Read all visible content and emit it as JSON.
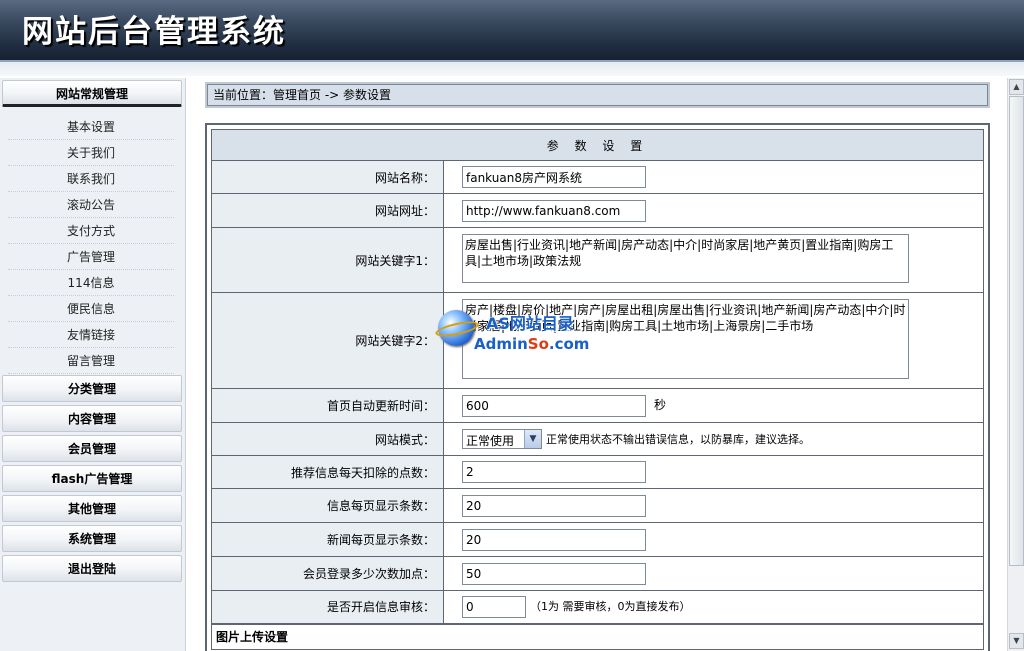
{
  "header": {
    "title": "网站后台管理系统"
  },
  "sidebar": {
    "active_category": "网站常规管理",
    "sub_items": [
      "基本设置",
      "关于我们",
      "联系我们",
      "滚动公告",
      "支付方式",
      "广告管理",
      "114信息",
      "便民信息",
      "友情链接",
      "留言管理"
    ],
    "categories": [
      "分类管理",
      "内容管理",
      "会员管理",
      "flash广告管理",
      "其他管理",
      "系统管理"
    ],
    "logout": "退出登陆"
  },
  "breadcrumb": "当前位置：管理首页 -> 参数设置",
  "form": {
    "title": "参 数 设 置",
    "site_name": {
      "label": "网站名称：",
      "value": "fankuan8房产网系统"
    },
    "site_url": {
      "label": "网站网址：",
      "value": "http://www.fankuan8.com"
    },
    "keywords1": {
      "label": "网站关键字1：",
      "value": "房屋出售|行业资讯|地产新闻|房产动态|中介|时尚家居|地产黄页|置业指南|购房工具|土地市场|政策法规"
    },
    "keywords2": {
      "label": "网站关键字2：",
      "value": "房产|楼盘|房价|地产|房产|房屋出租|房屋出售|行业资讯|地产新闻|房产动态|中介|时尚家居|地产黄页|置业指南|购房工具|土地市场|上海景房|二手市场"
    },
    "refresh": {
      "label": "首页自动更新时间：",
      "value": "600",
      "unit": "秒"
    },
    "mode": {
      "label": "网站模式：",
      "selected": "正常使用",
      "note": "正常使用状态不输出错误信息，以防暴库，建议选择。"
    },
    "deduct_points": {
      "label": "推荐信息每天扣除的点数：",
      "value": "2"
    },
    "info_per_page": {
      "label": "信息每页显示条数：",
      "value": "20"
    },
    "news_per_page": {
      "label": "新闻每页显示条数：",
      "value": "20"
    },
    "login_bonus": {
      "label": "会员登录多少次数加点：",
      "value": "50"
    },
    "audit": {
      "label": "是否开启信息审核：",
      "value": "0",
      "note": "（1为 需要审核，0为直接发布）"
    },
    "upload_section": "图片上传设置"
  },
  "watermark": {
    "line1": "AS网站目录",
    "line2_a": "Admin",
    "line2_b": "So",
    "line2_c": ".com"
  },
  "scrollbar": {
    "up": "▲",
    "down": "▼"
  }
}
